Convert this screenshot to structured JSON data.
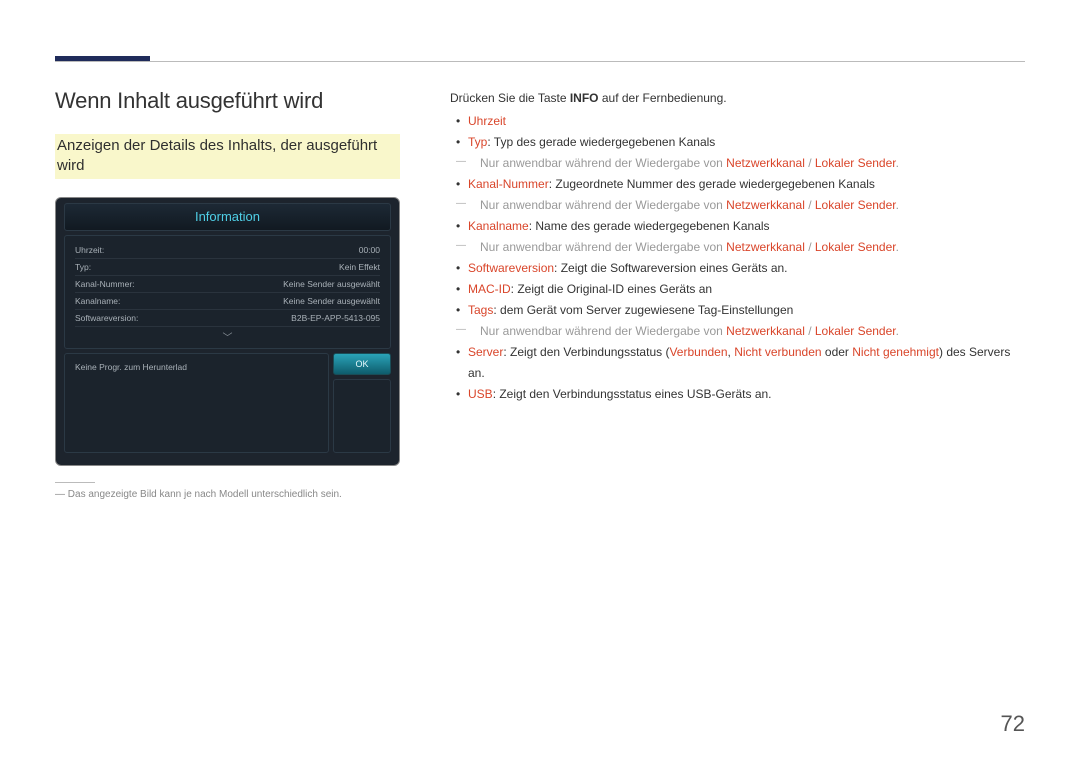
{
  "page_number": "72",
  "heading": "Wenn Inhalt ausgeführt wird",
  "subheading": "Anzeigen der Details des Inhalts, der ausgeführt wird",
  "screenshot": {
    "title": "Information",
    "rows": {
      "uhrzeit_label": "Uhrzeit:",
      "uhrzeit_value": "00:00",
      "typ_label": "Typ:",
      "typ_value": "Kein Effekt",
      "kanalnr_label": "Kanal-Nummer:",
      "kanalnr_value": "Keine Sender ausgewählt",
      "kanalname_label": "Kanalname:",
      "kanalname_value": "Keine Sender ausgewählt",
      "swver_label": "Softwareversion:",
      "swver_value": "B2B-EP-APP-5413-095"
    },
    "download_text": "Keine Progr. zum Herunterlad",
    "ok_label": "OK",
    "chevron": "﹀"
  },
  "footnote_dash": "―",
  "footnote": "Das angezeigte Bild kann je nach Modell unterschiedlich sein.",
  "right": {
    "intro_pre": "Drücken Sie die Taste ",
    "intro_bold": "INFO",
    "intro_post": " auf der Fernbedienung.",
    "uhrzeit": "Uhrzeit",
    "typ_label": "Typ",
    "typ_desc": ": Typ des gerade wiedergegebenen Kanals",
    "sub_pre": "Nur anwendbar während der Wiedergabe von ",
    "netzwerkkanal": "Netzwerkkanal",
    "slash": " / ",
    "lokaler": "Lokaler Sender",
    "dot": ".",
    "kanalnr_label": "Kanal-Nummer",
    "kanalnr_desc": ": Zugeordnete Nummer des gerade wiedergegebenen Kanals",
    "kanalname_label": "Kanalname",
    "kanalname_desc": ": Name des gerade wiedergegebenen Kanals",
    "swver_label": "Softwareversion",
    "swver_desc": ": Zeigt die Softwareversion eines Geräts an.",
    "mac_label": "MAC-ID",
    "mac_desc": ": Zeigt die Original-ID eines Geräts an",
    "tags_label": "Tags",
    "tags_desc": ": dem Gerät vom Server zugewiesene Tag-Einstellungen",
    "server_label": "Server",
    "server_pre": ": Zeigt den Verbindungsstatus (",
    "verbunden": "Verbunden",
    "comma": ", ",
    "nicht_verbunden": "Nicht verbunden",
    "oder": " oder ",
    "nicht_genehmigt": "Nicht genehmigt",
    "server_post": ") des Servers an.",
    "usb_label": "USB",
    "usb_desc": ": Zeigt den Verbindungsstatus eines USB-Geräts an."
  }
}
